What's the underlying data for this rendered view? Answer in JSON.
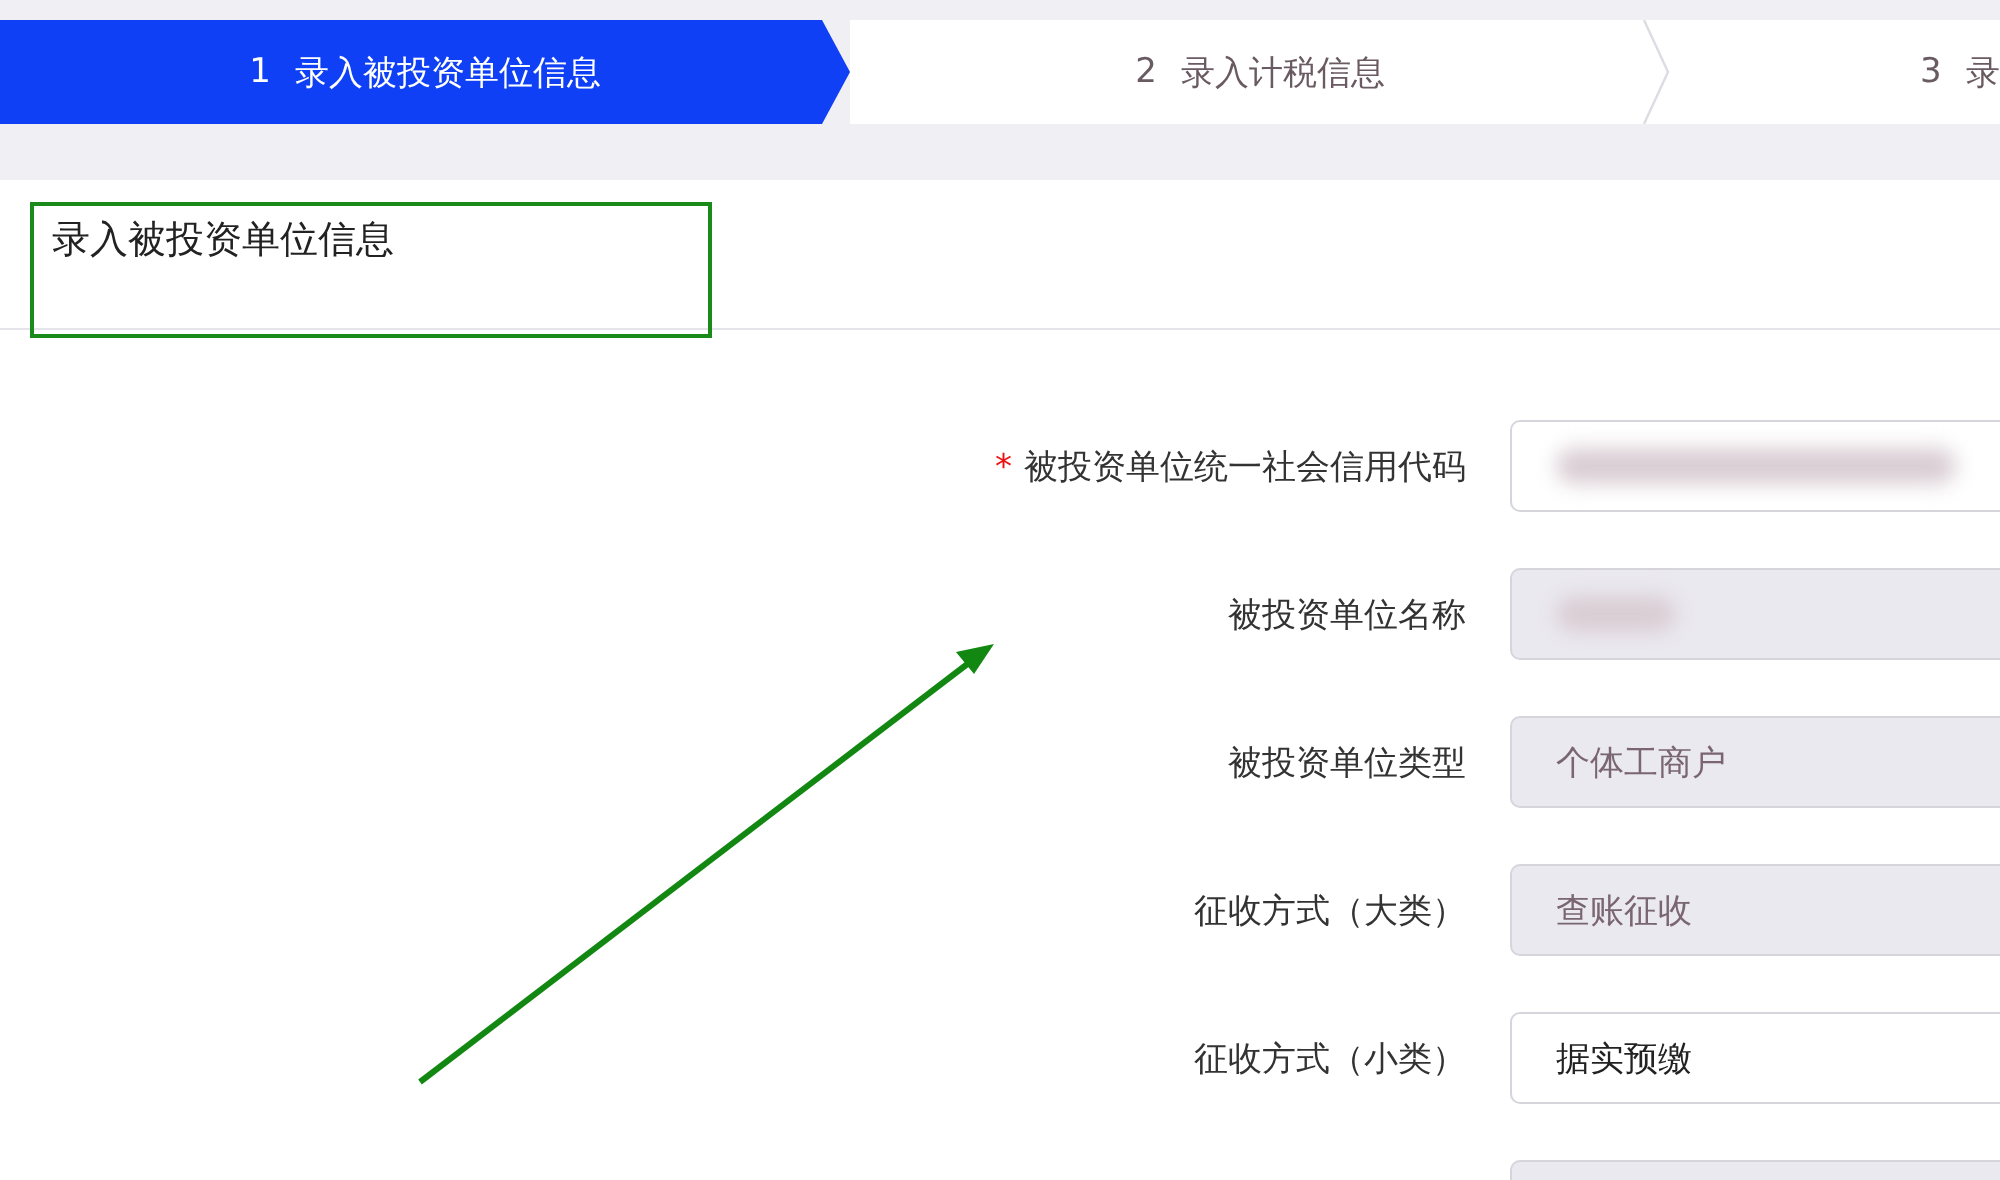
{
  "steps": [
    {
      "number": "1",
      "label": "录入被投资单位信息",
      "selected": true
    },
    {
      "number": "2",
      "label": "录入计税信息",
      "selected": false
    },
    {
      "number": "3",
      "label": "录",
      "selected": false
    }
  ],
  "section": {
    "title": "录入被投资单位信息"
  },
  "fields": [
    {
      "label": "被投资单位统一社会信用代码",
      "required_mark": "*",
      "kind": "blurred"
    },
    {
      "label": "被投资单位名称",
      "kind": "blurred-readonly"
    },
    {
      "label": "被投资单位类型",
      "kind": "readonly",
      "value": "个体工商户"
    },
    {
      "label": "征收方式（大类）",
      "kind": "readonly",
      "value": "查账征收"
    },
    {
      "label": "征收方式（小类）",
      "kind": "editable",
      "value": "据实预缴"
    },
    {
      "kind": "readonly"
    }
  ]
}
